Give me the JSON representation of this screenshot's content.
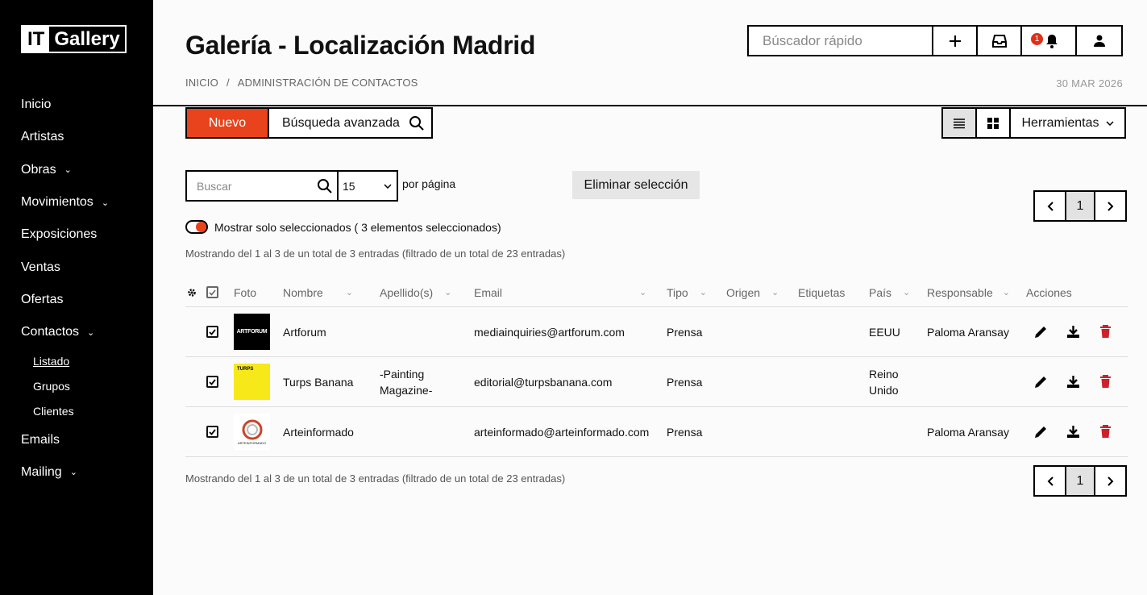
{
  "sidebar": {
    "logo_it": "IT",
    "logo_gallery": "Gallery",
    "items": [
      {
        "label": "Inicio"
      },
      {
        "label": "Artistas"
      },
      {
        "label": "Obras"
      },
      {
        "label": "Movimientos"
      },
      {
        "label": "Exposiciones"
      },
      {
        "label": "Ventas"
      },
      {
        "label": "Ofertas"
      },
      {
        "label": "Contactos"
      }
    ],
    "contactos_sub": [
      {
        "label": "Listado"
      },
      {
        "label": "Grupos"
      },
      {
        "label": "Clientes"
      }
    ],
    "items_after": [
      {
        "label": "Emails"
      },
      {
        "label": "Mailing"
      }
    ]
  },
  "header": {
    "title": "Galería - Localización Madrid",
    "breadcrumb": [
      "INICIO",
      "/",
      "ADMINISTRACIÓN DE CONTACTOS"
    ],
    "date": "30 MAR 2026",
    "quick_search_placeholder": "Búscador rápido",
    "notification_count": "1"
  },
  "toolbar": {
    "new_label": "Nuevo",
    "advanced_search_label": "Búsqueda avanzada",
    "tools_label": "Herramientas"
  },
  "filters": {
    "search_placeholder": "Buscar",
    "per_page_value": "15",
    "per_page_label": "por página",
    "delete_selection_label": "Eliminar selección",
    "show_selected_label": "Mostrar solo seleccionados ( 3 elementos seleccionados)",
    "show_selected_on": true
  },
  "pagination": {
    "current_page": "1",
    "info_text": "Mostrando del 1 al 3 de un total de 3 entradas (filtrado de un total de 23 entradas)"
  },
  "table": {
    "columns": {
      "foto": "Foto",
      "nombre": "Nombre",
      "apellidos": "Apellido(s)",
      "email": "Email",
      "tipo": "Tipo",
      "origen": "Origen",
      "etiquetas": "Etiquetas",
      "pais": "País",
      "responsable": "Responsable",
      "acciones": "Acciones"
    },
    "rows": [
      {
        "thumb_text": "ARTFORUM",
        "nombre": "Artforum",
        "apellidos_1": "",
        "apellidos_2": "",
        "email": "mediainquiries@artforum.com",
        "tipo": "Prensa",
        "pais_1": "EEUU",
        "pais_2": "",
        "responsable": "Paloma Aransay",
        "selected": true
      },
      {
        "thumb_text": "TURPS",
        "nombre": "Turps Banana",
        "apellidos_1": "-Painting",
        "apellidos_2": "Magazine-",
        "email": "editorial@turpsbanana.com",
        "tipo": "Prensa",
        "pais_1": "Reino",
        "pais_2": "Unido",
        "responsable": "",
        "selected": true
      },
      {
        "thumb_text": "ARTEINFORMADO",
        "nombre": "Arteinformado",
        "apellidos_1": "",
        "apellidos_2": "",
        "email": "arteinformado@arteinformado.com",
        "tipo": "Prensa",
        "pais_1": "",
        "pais_2": "",
        "responsable": "Paloma Aransay",
        "selected": true
      }
    ]
  },
  "colors": {
    "accent": "#e8431c",
    "delete_icon": "#d0202a",
    "sidebar_bg": "#000000"
  }
}
